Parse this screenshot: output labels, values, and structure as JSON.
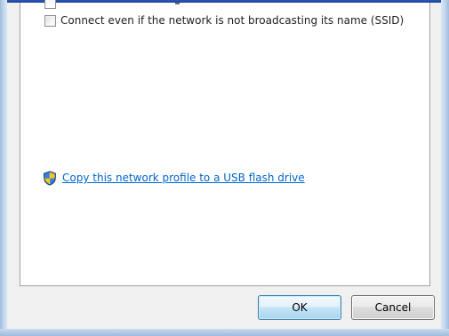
{
  "options": {
    "ssid_checkbox_label": "Connect even if the network is not broadcasting its name (SSID)",
    "ssid_checked": false
  },
  "links": {
    "usb_copy_label": "Copy this network profile to a USB flash drive"
  },
  "buttons": {
    "ok_label": "OK",
    "cancel_label": "Cancel"
  },
  "icons": {
    "shield": "uac-shield-icon"
  },
  "colors": {
    "link": "#0066cc",
    "frame": "#b9d1ea"
  }
}
